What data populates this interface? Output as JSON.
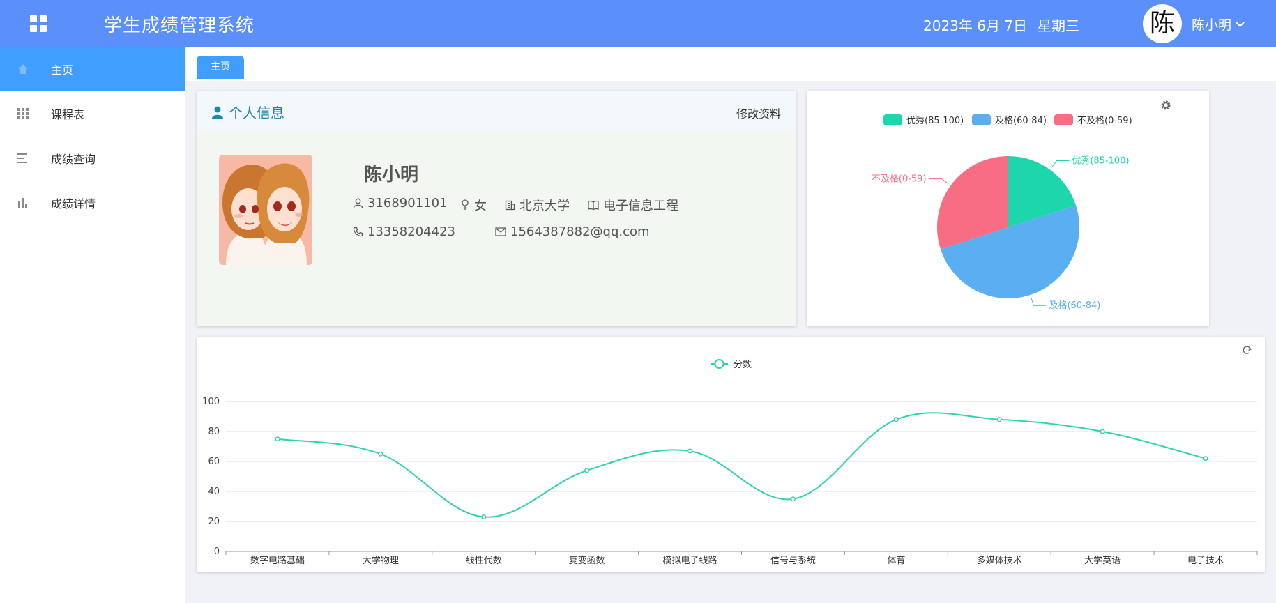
{
  "header": {
    "title": "学生成绩管理系统",
    "date": "2023年 6月 7日",
    "weekday": "星期三",
    "avatar_char": "陈",
    "user_name": "陈小明"
  },
  "sidebar": {
    "items": [
      {
        "label": "主页",
        "icon": "home-icon",
        "active": true
      },
      {
        "label": "课程表",
        "icon": "grid-icon",
        "active": false
      },
      {
        "label": "成绩查询",
        "icon": "list-icon",
        "active": false
      },
      {
        "label": "成绩详情",
        "icon": "bar-chart-icon",
        "active": false
      }
    ]
  },
  "tabs": [
    {
      "label": "主页"
    }
  ],
  "profile": {
    "title": "个人信息",
    "edit_label": "修改资料",
    "name": "陈小明",
    "student_id": "3168901101",
    "gender": "女",
    "school": "北京大学",
    "major": "电子信息工程",
    "phone": "13358204423",
    "email": "1564387882@qq.com"
  },
  "colors": {
    "header": "#5b8ff9",
    "accent": "#409eff",
    "excellent": "#1ed6ac",
    "pass": "#5aaff0",
    "fail": "#f76d84",
    "line": "#2ed4b0"
  },
  "chart_data": [
    {
      "type": "pie",
      "legend_position": "top",
      "slices": [
        {
          "label": "优秀(85-100)",
          "value": 2,
          "color": "#1ed6ac"
        },
        {
          "label": "及格(60-84)",
          "value": 5,
          "color": "#5aaff0"
        },
        {
          "label": "不及格(0-59)",
          "value": 3,
          "color": "#f76d84"
        }
      ],
      "toolbox_icon": "gear-icon"
    },
    {
      "type": "line",
      "smooth": true,
      "series": [
        {
          "name": "分数",
          "values": [
            75,
            65,
            23,
            54,
            67,
            35,
            88,
            88,
            80,
            62
          ],
          "color": "#2ed4b0"
        }
      ],
      "categories": [
        "数字电路基础",
        "大学物理",
        "线性代数",
        "复变函数",
        "模拟电子线路",
        "信号与系统",
        "体育",
        "多媒体技术",
        "大学英语",
        "电子技术"
      ],
      "ylim": [
        0,
        100
      ],
      "yticks": [
        0,
        20,
        40,
        60,
        80,
        100
      ],
      "grid": true,
      "legend_position": "top",
      "toolbox_icon": "refresh-icon"
    }
  ]
}
